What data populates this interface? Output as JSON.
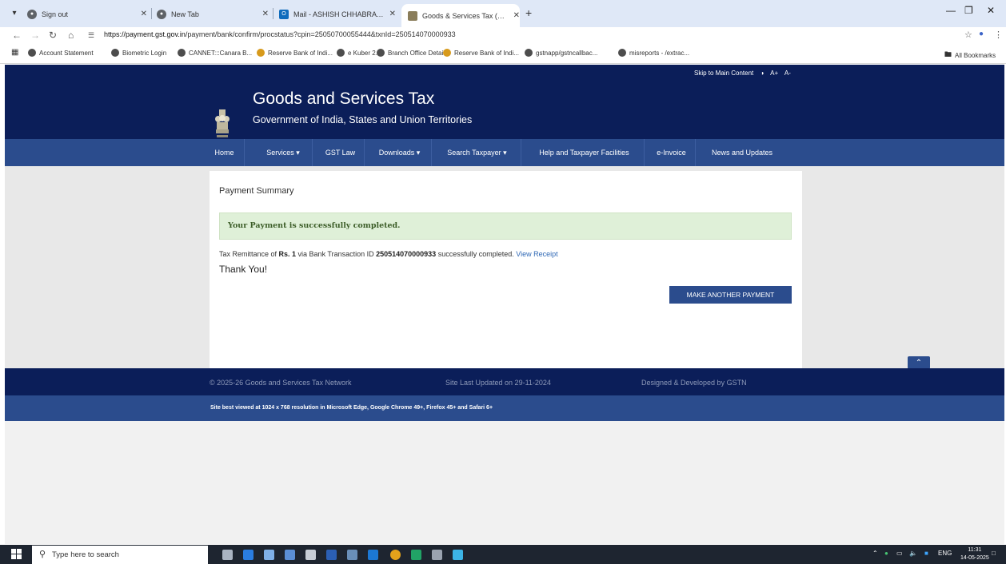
{
  "browser": {
    "tabs": [
      {
        "title": "Sign out",
        "icon": "globe-icon"
      },
      {
        "title": "New Tab",
        "icon": "globe-icon"
      },
      {
        "title": "Mail - ASHISH CHHABRA - Out",
        "icon": "outlook-icon"
      },
      {
        "title": "Goods & Services Tax (GST) | Pa",
        "icon": "gst-emblem-icon"
      }
    ],
    "url_host": "https://payment.gst.gov.in",
    "url_path": "/payment/bank/confirm/procstatus?cpin=25050700055444&txnId=250514070000933",
    "bookmarks": [
      "Account Statement",
      "Biometric Login",
      "CANNET:::Canara B...",
      "Reserve Bank of Indi...",
      "e Kuber 2.0",
      "Branch Office Details",
      "Reserve Bank of Indi...",
      "gstnapp/gstncallbac...",
      "misreports - /extrac..."
    ],
    "all_bookmarks": "All Bookmarks"
  },
  "site": {
    "skip_link": "Skip to Main Content",
    "font_large": "A+",
    "font_small": "A-",
    "title": "Goods and Services Tax",
    "subtitle": "Government of India, States and Union Territories",
    "nav": [
      "Home",
      "Services ▾",
      "GST Law",
      "Downloads ▾",
      "Search Taxpayer ▾",
      "Help and Taxpayer Facilities",
      "e-Invoice",
      "News and Updates"
    ]
  },
  "payment": {
    "heading": "Payment Summary",
    "success_message": "Your Payment is successfully completed.",
    "remit_prefix": "Tax Remittance of ",
    "amount": "Rs. 1",
    "remit_middle": " via Bank Transaction ID ",
    "transaction_id": "250514070000933",
    "remit_suffix": " successfully completed. ",
    "receipt_link": "View Receipt",
    "thanks": "Thank You!",
    "another_button": "MAKE ANOTHER PAYMENT"
  },
  "footer": {
    "copyright": "© 2025-26 Goods and Services Tax Network",
    "updated": "Site Last Updated on 29-11-2024",
    "designed": "Designed & Developed by GSTN",
    "best_viewed": "Site best viewed at 1024 x 768 resolution in Microsoft Edge, Google Chrome 49+, Firefox 45+ and Safari 6+"
  },
  "taskbar": {
    "search_placeholder": "Type here to search",
    "language": "ENG",
    "time": "11:31",
    "date": "14-05-2025"
  },
  "colors": {
    "header_navy": "#0b1e59",
    "nav_blue": "#2b4c8d",
    "success_bg": "#dff0d8",
    "link": "#2f68b5"
  }
}
